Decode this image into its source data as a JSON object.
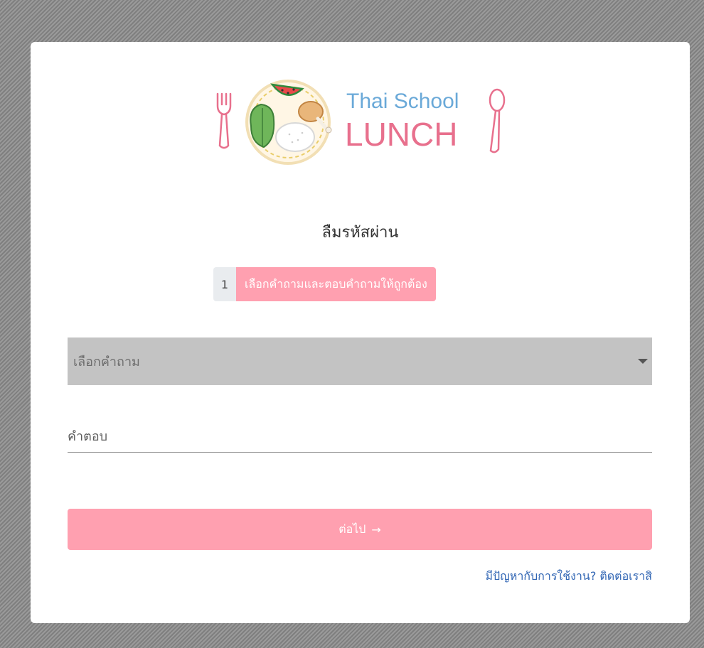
{
  "logo": {
    "line1": "Thai School",
    "line2": "LUNCH"
  },
  "form": {
    "title": "ลืมรหัสผ่าน",
    "step_number": "1",
    "step_label": "เลือกคำถามและตอบคำถามให้ถูกต้อง",
    "question_select": {
      "selected": "เลือกคำถาม"
    },
    "answer_input": {
      "placeholder": "คำตอบ",
      "value": ""
    },
    "next_button": {
      "label": "ต่อไป",
      "icon": "arrow-right-icon"
    },
    "help_link": "มีปัญหากับการใช้งาน? ติดต่อเราสิ"
  },
  "colors": {
    "accent_pink": "#ffa0b0",
    "logo_blue": "#6aa9d8",
    "logo_pink": "#e8708d",
    "link_blue": "#2f64b3",
    "select_bg": "#c3c3c3"
  }
}
